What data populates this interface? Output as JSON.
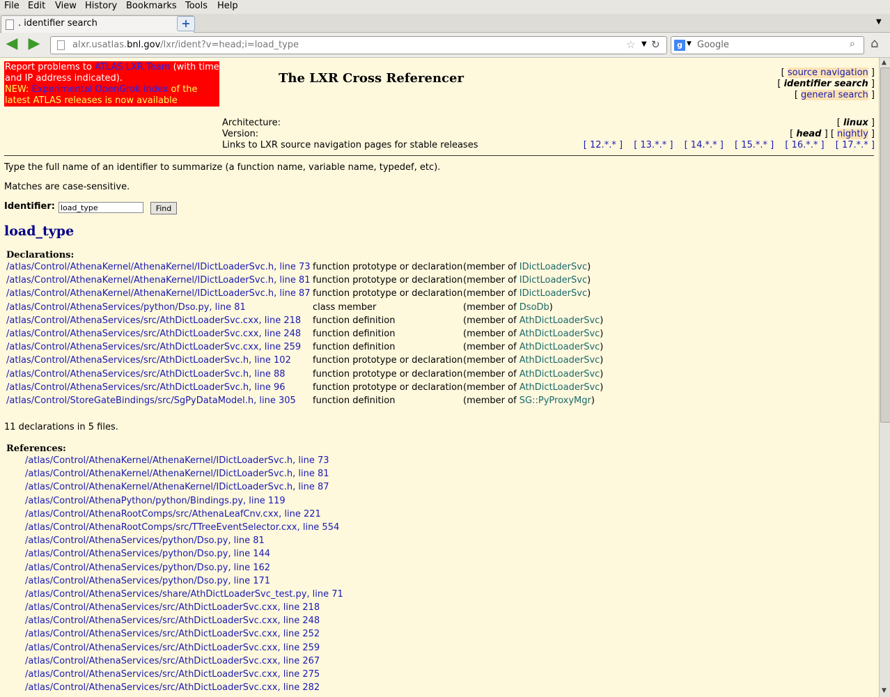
{
  "menu": [
    "File",
    "Edit",
    "View",
    "History",
    "Bookmarks",
    "Tools",
    "Help"
  ],
  "tab": {
    "title": ". identifier search"
  },
  "nav": {
    "url_prefix": "alxr.usatlas.",
    "url_domain": "bnl.gov",
    "url_path": "/lxr/ident?v=head;i=load_type",
    "search_placeholder": "Google"
  },
  "notice": {
    "t1": "Report problems to ",
    "link1": "ATLAS LXR Team",
    "t2": " (with time and IP address indicated).",
    "new": "NEW: ",
    "link2": "Experimental OpenGrok index",
    "t3": " of the latest ATLAS releases is now available"
  },
  "title": "The LXR Cross Referencer",
  "toplinks": [
    "source navigation",
    "identifier search",
    "general search"
  ],
  "meta": {
    "arch_label": "Architecture:",
    "version_label": "Version:",
    "links_label": "Links to LXR source navigation pages for stable releases",
    "arch": "linux",
    "versions": [
      "head",
      "nightly"
    ],
    "releases": [
      "12.*.*",
      "13.*.*",
      "14.*.*",
      "15.*.*",
      "16.*.*",
      "17.*.*"
    ]
  },
  "intro1": "Type the full name of an identifier to summarize (a function name, variable name, typedef, etc).",
  "intro2": "Matches are case-sensitive.",
  "identifier_label": "Identifier:",
  "identifier_value": "load_type",
  "find_label": "Find",
  "ident_heading": "load_type",
  "declarations_heading": "Declarations:",
  "declarations": [
    {
      "file": "/atlas/Control/AthenaKernel/AthenaKernel/IDictLoaderSvc.h, line 73",
      "kind": "function prototype or declaration",
      "member": "IDictLoaderSvc"
    },
    {
      "file": "/atlas/Control/AthenaKernel/AthenaKernel/IDictLoaderSvc.h, line 81",
      "kind": "function prototype or declaration",
      "member": "IDictLoaderSvc"
    },
    {
      "file": "/atlas/Control/AthenaKernel/AthenaKernel/IDictLoaderSvc.h, line 87",
      "kind": "function prototype or declaration",
      "member": "IDictLoaderSvc"
    },
    {
      "file": "/atlas/Control/AthenaServices/python/Dso.py, line 81",
      "kind": "class member",
      "member": "DsoDb"
    },
    {
      "file": "/atlas/Control/AthenaServices/src/AthDictLoaderSvc.cxx, line 218",
      "kind": "function definition",
      "member": "AthDictLoaderSvc"
    },
    {
      "file": "/atlas/Control/AthenaServices/src/AthDictLoaderSvc.cxx, line 248",
      "kind": "function definition",
      "member": "AthDictLoaderSvc"
    },
    {
      "file": "/atlas/Control/AthenaServices/src/AthDictLoaderSvc.cxx, line 259",
      "kind": "function definition",
      "member": "AthDictLoaderSvc"
    },
    {
      "file": "/atlas/Control/AthenaServices/src/AthDictLoaderSvc.h, line 102",
      "kind": "function prototype or declaration",
      "member": "AthDictLoaderSvc"
    },
    {
      "file": "/atlas/Control/AthenaServices/src/AthDictLoaderSvc.h, line 88",
      "kind": "function prototype or declaration",
      "member": "AthDictLoaderSvc"
    },
    {
      "file": "/atlas/Control/AthenaServices/src/AthDictLoaderSvc.h, line 96",
      "kind": "function prototype or declaration",
      "member": "AthDictLoaderSvc"
    },
    {
      "file": "/atlas/Control/StoreGateBindings/src/SgPyDataModel.h, line 305",
      "kind": "function definition",
      "member": "SG::PyProxyMgr"
    }
  ],
  "member_prefix": "(member of ",
  "member_suffix": ")",
  "summary": "11 declarations in 5 files.",
  "references_heading": "References:",
  "references": [
    "/atlas/Control/AthenaKernel/AthenaKernel/IDictLoaderSvc.h, line 73",
    "/atlas/Control/AthenaKernel/AthenaKernel/IDictLoaderSvc.h, line 81",
    "/atlas/Control/AthenaKernel/AthenaKernel/IDictLoaderSvc.h, line 87",
    "/atlas/Control/AthenaPython/python/Bindings.py, line 119",
    "/atlas/Control/AthenaRootComps/src/AthenaLeafCnv.cxx, line 221",
    "/atlas/Control/AthenaRootComps/src/TTreeEventSelector.cxx, line 554",
    "/atlas/Control/AthenaServices/python/Dso.py, line 81",
    "/atlas/Control/AthenaServices/python/Dso.py, line 144",
    "/atlas/Control/AthenaServices/python/Dso.py, line 162",
    "/atlas/Control/AthenaServices/python/Dso.py, line 171",
    "/atlas/Control/AthenaServices/share/AthDictLoaderSvc_test.py, line 71",
    "/atlas/Control/AthenaServices/src/AthDictLoaderSvc.cxx, line 218",
    "/atlas/Control/AthenaServices/src/AthDictLoaderSvc.cxx, line 248",
    "/atlas/Control/AthenaServices/src/AthDictLoaderSvc.cxx, line 252",
    "/atlas/Control/AthenaServices/src/AthDictLoaderSvc.cxx, line 259",
    "/atlas/Control/AthenaServices/src/AthDictLoaderSvc.cxx, line 267",
    "/atlas/Control/AthenaServices/src/AthDictLoaderSvc.cxx, line 275",
    "/atlas/Control/AthenaServices/src/AthDictLoaderSvc.cxx, line 282"
  ]
}
